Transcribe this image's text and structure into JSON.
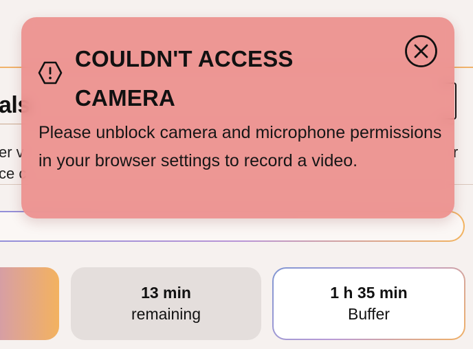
{
  "background": {
    "heading_fragment": "als",
    "description_left": [
      "er v",
      "ce c"
    ],
    "description_right": "r"
  },
  "stats": {
    "remaining": {
      "value": "13 min",
      "label": "remaining"
    },
    "buffer": {
      "value": "1 h 35 min",
      "label": "Buffer"
    }
  },
  "alert": {
    "title": "COULDN'T ACCESS CAMERA",
    "message": "Please unblock camera and microphone permissions in your browser settings to record a video.",
    "icon": "warning-icon",
    "close_icon": "close-icon"
  },
  "colors": {
    "alert_background": "#ec8a88",
    "accent_orange": "#f3b25f",
    "accent_purple": "#b99bd6",
    "accent_blue": "#8096d2"
  }
}
